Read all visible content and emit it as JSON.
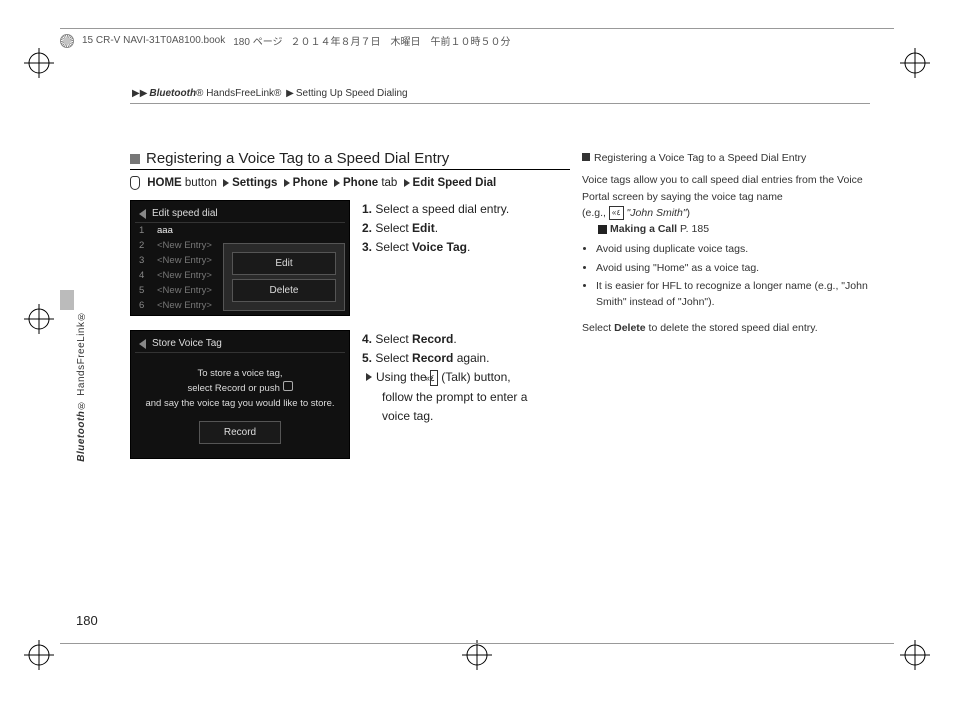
{
  "header": {
    "filename": "15 CR-V NAVI-31T0A8100.book",
    "page_jp": "180 ページ",
    "date_jp": "２０１４年８月７日　木曜日　午前１０時５０分"
  },
  "breadcrumb": {
    "a": "Bluetooth",
    "b": "HandsFreeLink®",
    "c": "Setting Up Speed Dialing"
  },
  "section": {
    "title": "Registering a Voice Tag to a Speed Dial Entry"
  },
  "path": {
    "home_bold": "HOME",
    "home_rest": " button",
    "settings": "Settings",
    "phone1": "Phone",
    "phone_tab_bold": "Phone",
    "phone_tab_rest": " tab",
    "edit": "Edit Speed Dial"
  },
  "screen1": {
    "title": "Edit speed dial",
    "rows": [
      {
        "n": "1",
        "label": "aaa"
      },
      {
        "n": "2",
        "label": "<New Entry>"
      },
      {
        "n": "3",
        "label": "<New Entry>"
      },
      {
        "n": "4",
        "label": "<New Entry>"
      },
      {
        "n": "5",
        "label": "<New Entry>"
      },
      {
        "n": "6",
        "label": "<New Entry>"
      }
    ],
    "popup": {
      "edit": "Edit",
      "delete": "Delete"
    }
  },
  "steps1": {
    "s1a": "1.",
    "s1b": "Select a speed dial entry.",
    "s2a": "2.",
    "s2b": "Select ",
    "s2c": "Edit",
    "s2d": ".",
    "s3a": "3.",
    "s3b": "Select ",
    "s3c": "Voice Tag",
    "s3d": "."
  },
  "screen2": {
    "title": "Store Voice Tag",
    "l1": "To store a voice tag,",
    "l2": "select Record or push ",
    "l3": "and say the voice tag you would like to store.",
    "record": "Record"
  },
  "steps2": {
    "s4a": "4.",
    "s4b": "Select ",
    "s4c": "Record",
    "s4d": ".",
    "s5a": "5.",
    "s5b": "Select ",
    "s5c": "Record",
    "s5d": " again.",
    "sub1": "Using the ",
    "sub_talk": "(Talk) button,",
    "sub2": "follow the prompt to enter a",
    "sub3": "voice tag."
  },
  "sidebar": {
    "title": "Registering a Voice Tag to a Speed Dial Entry",
    "p1": "Voice tags allow you to call speed dial entries from the Voice Portal screen by saying the voice tag name",
    "eg_open": "(e.g., ",
    "eg_name": "\"John Smith\"",
    "eg_close": ")",
    "link_label": "Making a Call",
    "link_page": "P. 185",
    "b1": "Avoid using duplicate voice tags.",
    "b2": "Avoid using \"Home\" as a voice tag.",
    "b3": "It is easier for HFL to recognize a longer name (e.g., \"John Smith\" instead of \"John\").",
    "p2a": "Select ",
    "p2b": "Delete",
    "p2c": " to delete the stored speed dial entry."
  },
  "sidetab": {
    "a": "Bluetooth",
    "b": "® HandsFreeLink®"
  },
  "page_number": "180"
}
